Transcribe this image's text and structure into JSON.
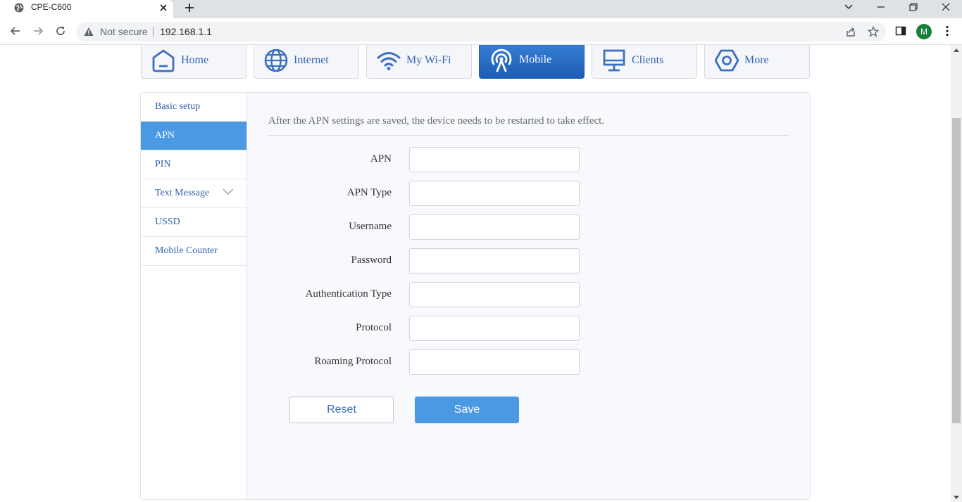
{
  "browser": {
    "tab_title": "CPE-C600",
    "security_label": "Not secure",
    "url": "192.168.1.1",
    "profile_initial": "M"
  },
  "nav": {
    "items": [
      {
        "label": "Home",
        "icon": "home-icon"
      },
      {
        "label": "Internet",
        "icon": "globe-icon"
      },
      {
        "label": "My Wi-Fi",
        "icon": "wifi-icon"
      },
      {
        "label": "Mobile",
        "icon": "antenna-icon",
        "active": true
      },
      {
        "label": "Clients",
        "icon": "monitor-icon"
      },
      {
        "label": "More",
        "icon": "hexagon-gear-icon"
      }
    ]
  },
  "sidebar": {
    "items": [
      {
        "label": "Basic setup"
      },
      {
        "label": "APN",
        "active": true
      },
      {
        "label": "PIN"
      },
      {
        "label": "Text Message",
        "has_submenu": true
      },
      {
        "label": "USSD"
      },
      {
        "label": "Mobile Counter"
      }
    ]
  },
  "content": {
    "notice": "After the APN settings are saved, the device needs to be restarted to take effect.",
    "fields": [
      {
        "label": "APN",
        "value": ""
      },
      {
        "label": "APN Type",
        "value": ""
      },
      {
        "label": "Username",
        "value": ""
      },
      {
        "label": "Password",
        "value": ""
      },
      {
        "label": "Authentication Type",
        "value": ""
      },
      {
        "label": "Protocol",
        "value": ""
      },
      {
        "label": "Roaming Protocol",
        "value": ""
      }
    ],
    "reset_label": "Reset",
    "save_label": "Save"
  },
  "colors": {
    "accent": "#4b98e3",
    "nav_active": "#2a6fc9",
    "link_text": "#2f5fa8"
  }
}
